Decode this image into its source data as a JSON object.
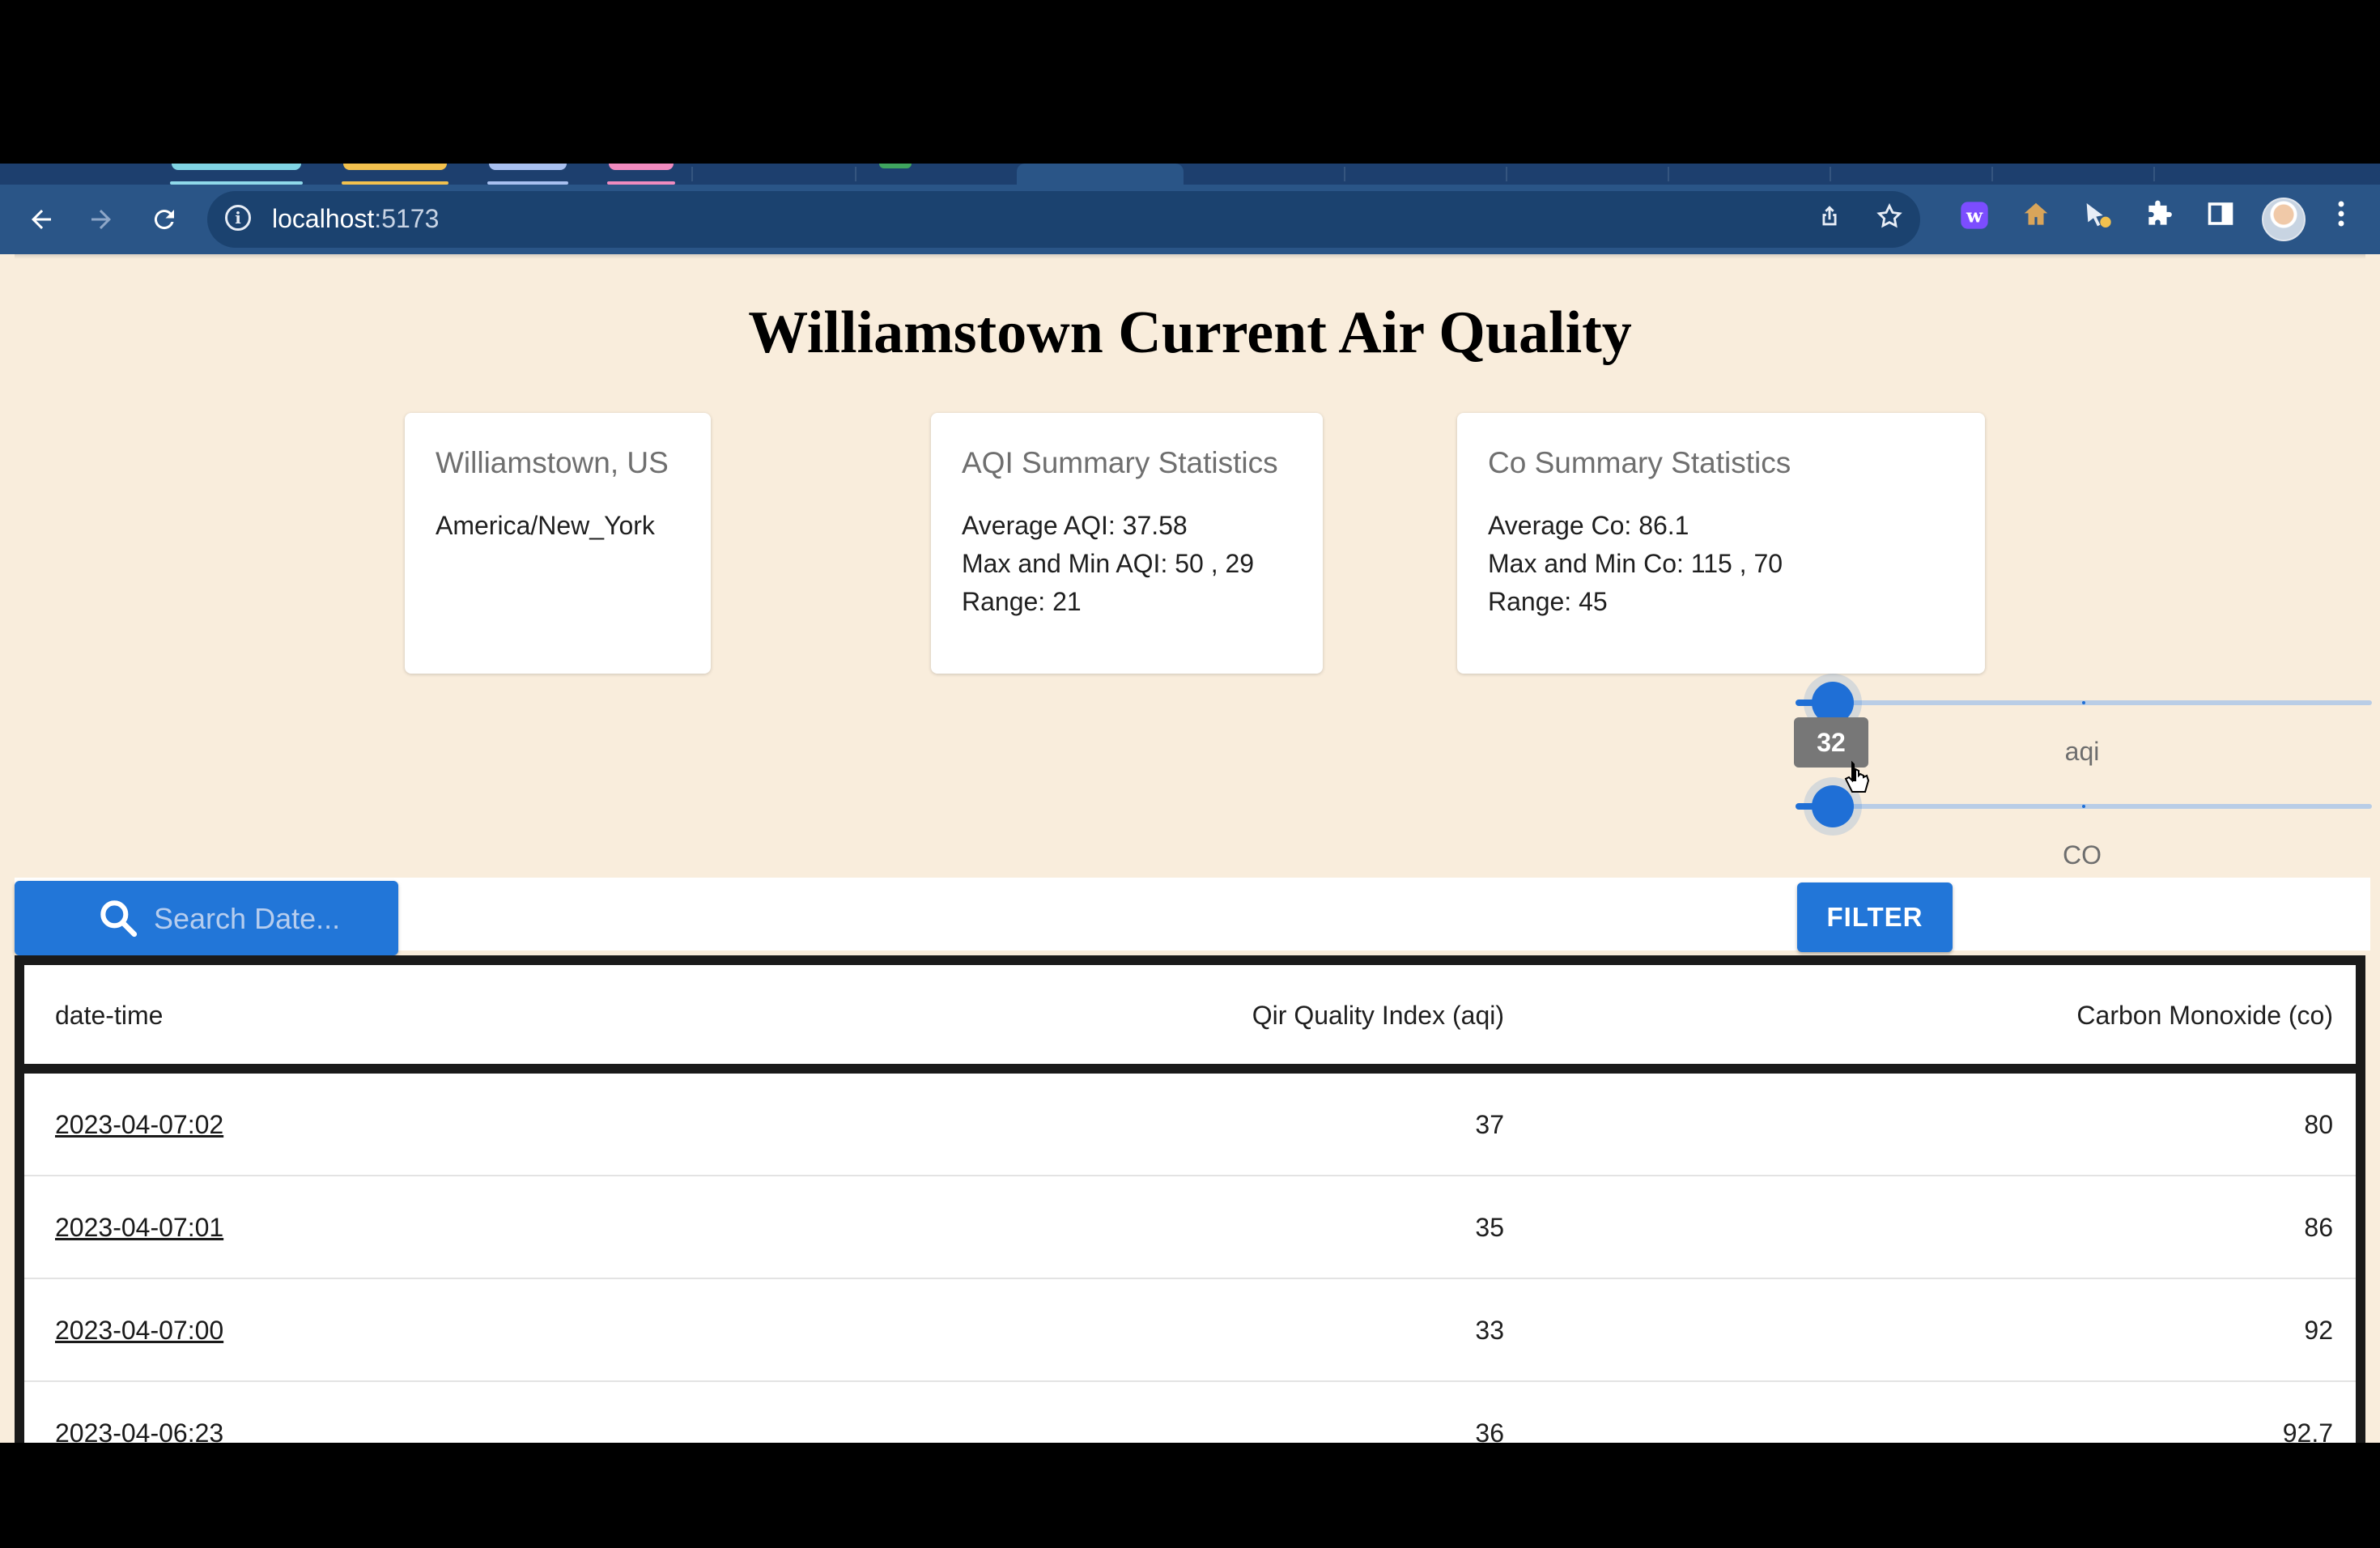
{
  "browser": {
    "url_host": "localhost",
    "url_port": ":5173",
    "icons": {
      "back": "back-arrow-icon",
      "forward": "forward-arrow-icon",
      "reload": "reload-icon",
      "site_info": "info-icon",
      "share": "share-icon",
      "bookmark": "star-icon",
      "extensions": "puzzle-icon",
      "side_panel": "side-panel-icon",
      "menu": "kebab-menu-icon"
    }
  },
  "page": {
    "title": "Williamstown Current Air Quality"
  },
  "cards": {
    "location": {
      "heading": "Williamstown, US",
      "timezone": "America/New_York"
    },
    "aqi": {
      "heading": "AQI Summary Statistics",
      "average": "Average AQI: 37.58",
      "maxmin": "Max and Min AQI: 50 , 29",
      "range": "Range: 21"
    },
    "co": {
      "heading": "Co Summary Statistics",
      "average": "Average Co: 86.1",
      "maxmin": "Max and Min Co: 115 , 70",
      "range": "Range: 45"
    }
  },
  "sliders": {
    "aqi": {
      "label": "aqi",
      "value_tooltip": "32"
    },
    "co": {
      "label": "CO"
    }
  },
  "search": {
    "placeholder": "Search Date..."
  },
  "filter": {
    "label": "FILTER"
  },
  "table": {
    "headers": [
      "date-time",
      "Qir Quality Index (aqi)",
      "Carbon Monoxide (co)"
    ],
    "rows": [
      {
        "datetime": "2023-04-07:02",
        "aqi": "37",
        "co": "80"
      },
      {
        "datetime": "2023-04-07:01",
        "aqi": "35",
        "co": "86"
      },
      {
        "datetime": "2023-04-07:00",
        "aqi": "33",
        "co": "92"
      },
      {
        "datetime": "2023-04-06:23",
        "aqi": "36",
        "co": "92.7"
      }
    ]
  },
  "colors": {
    "page_bg": "#f9eddc",
    "accent": "#2276d8",
    "toolbar": "#2a5587"
  }
}
